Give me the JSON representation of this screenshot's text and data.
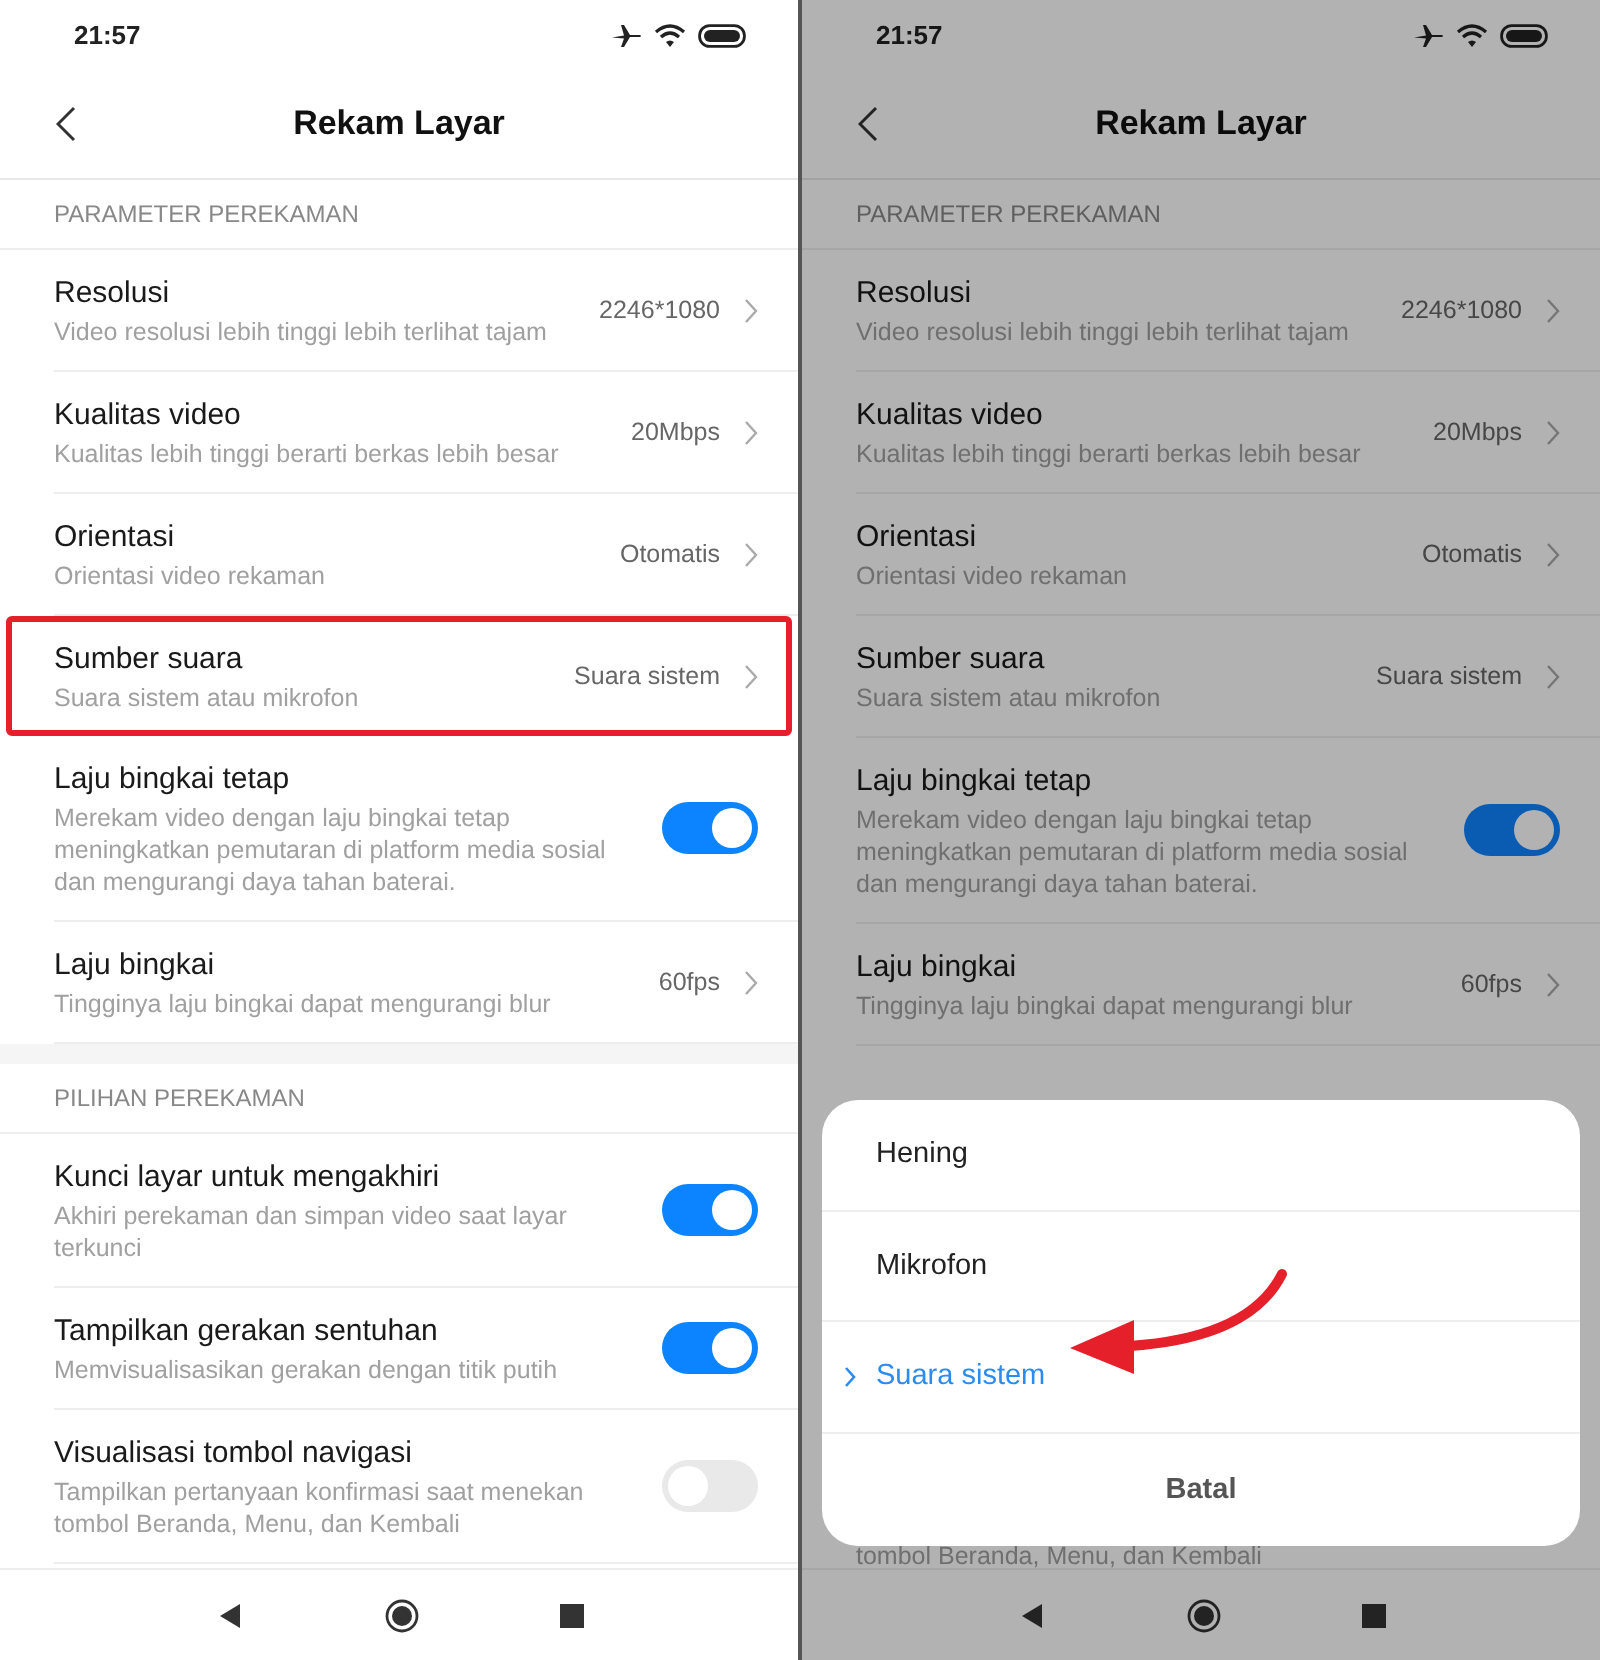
{
  "screens": [
    {
      "time": "21:57",
      "title": "Rekam Layar",
      "dimmed": false,
      "sections": [
        {
          "header": "PARAMETER PEREKAMAN",
          "rows": [
            {
              "kind": "value",
              "title": "Resolusi",
              "subtitle": "Video resolusi lebih tinggi lebih terlihat tajam",
              "value": "2246*1080",
              "highlighted": false
            },
            {
              "kind": "value",
              "title": "Kualitas video",
              "subtitle": "Kualitas lebih tinggi berarti berkas lebih besar",
              "value": "20Mbps",
              "highlighted": false
            },
            {
              "kind": "value",
              "title": "Orientasi",
              "subtitle": "Orientasi video rekaman",
              "value": "Otomatis",
              "highlighted": false
            },
            {
              "kind": "value",
              "title": "Sumber suara",
              "subtitle": "Suara sistem atau mikrofon",
              "value": "Suara sistem",
              "highlighted": true
            },
            {
              "kind": "toggle",
              "title": "Laju bingkai tetap",
              "subtitle": "Merekam video dengan laju bingkai tetap meningkatkan pemutaran di platform media sosial dan mengurangi daya tahan baterai.",
              "on": true
            },
            {
              "kind": "value",
              "title": "Laju bingkai",
              "subtitle": "Tingginya laju bingkai dapat mengurangi blur",
              "value": "60fps",
              "highlighted": false
            }
          ]
        },
        {
          "header": "PILIHAN PEREKAMAN",
          "rows": [
            {
              "kind": "toggle",
              "title": "Kunci layar untuk mengakhiri",
              "subtitle": "Akhiri perekaman dan simpan video saat layar terkunci",
              "on": true
            },
            {
              "kind": "toggle",
              "title": "Tampilkan gerakan sentuhan",
              "subtitle": "Memvisualisasikan gerakan dengan titik putih",
              "on": true
            },
            {
              "kind": "toggle",
              "title": "Visualisasi tombol navigasi",
              "subtitle": "Tampilkan pertanyaan konfirmasi saat menekan tombol Beranda, Menu, dan Kembali",
              "on": false
            }
          ]
        }
      ]
    },
    {
      "time": "21:57",
      "title": "Rekam Layar",
      "dimmed": true,
      "sections": [
        {
          "header": "PARAMETER PEREKAMAN",
          "rows": [
            {
              "kind": "value",
              "title": "Resolusi",
              "subtitle": "Video resolusi lebih tinggi lebih terlihat tajam",
              "value": "2246*1080",
              "highlighted": false
            },
            {
              "kind": "value",
              "title": "Kualitas video",
              "subtitle": "Kualitas lebih tinggi berarti berkas lebih besar",
              "value": "20Mbps",
              "highlighted": false
            },
            {
              "kind": "value",
              "title": "Orientasi",
              "subtitle": "Orientasi video rekaman",
              "value": "Otomatis",
              "highlighted": false
            },
            {
              "kind": "value",
              "title": "Sumber suara",
              "subtitle": "Suara sistem atau mikrofon",
              "value": "Suara sistem",
              "highlighted": false
            },
            {
              "kind": "toggle",
              "title": "Laju bingkai tetap",
              "subtitle": "Merekam video dengan laju bingkai tetap meningkatkan pemutaran di platform media sosial dan mengurangi daya tahan baterai.",
              "on": true
            },
            {
              "kind": "value",
              "title": "Laju bingkai",
              "subtitle": "Tingginya laju bingkai dapat mengurangi blur",
              "value": "60fps",
              "highlighted": false
            }
          ]
        }
      ],
      "peek_text": "tombol Beranda, Menu, dan Kembali",
      "sheet": {
        "options": [
          {
            "label": "Hening",
            "selected": false,
            "annotated": false
          },
          {
            "label": "Mikrofon",
            "selected": false,
            "annotated": false
          },
          {
            "label": "Suara sistem",
            "selected": true,
            "annotated": true
          }
        ],
        "cancel": "Batal"
      }
    }
  ]
}
